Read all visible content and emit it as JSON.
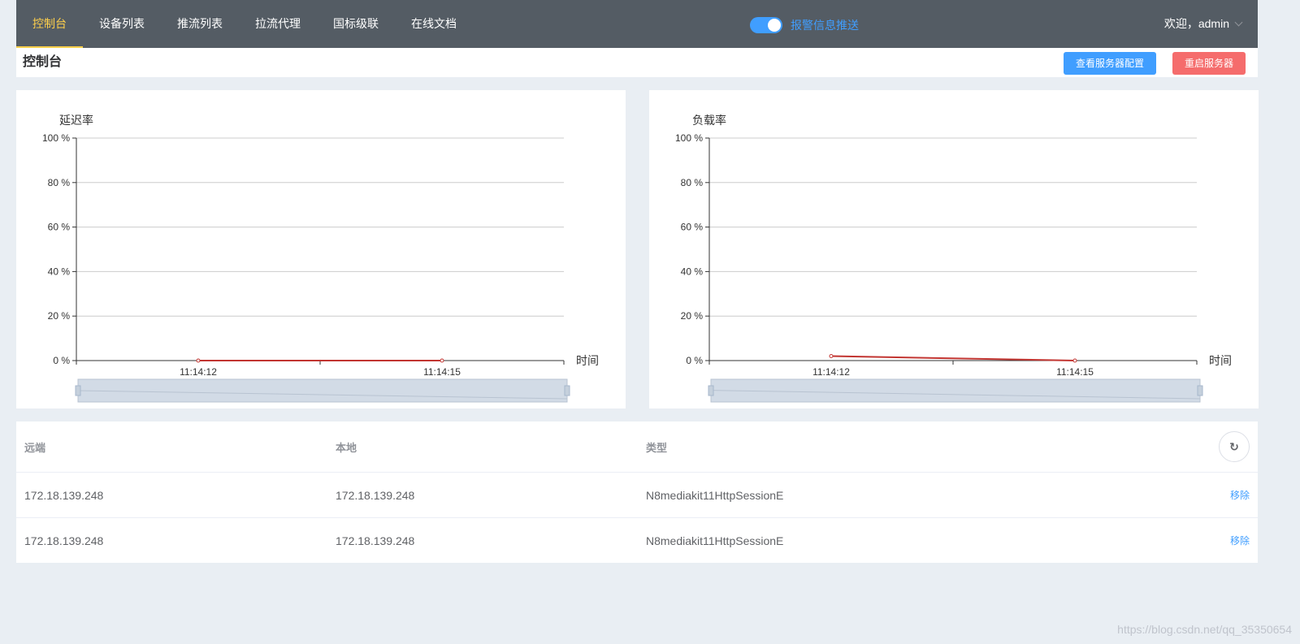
{
  "nav": {
    "items": [
      {
        "label": "控制台",
        "active": true
      },
      {
        "label": "设备列表"
      },
      {
        "label": "推流列表"
      },
      {
        "label": "拉流代理"
      },
      {
        "label": "国标级联"
      },
      {
        "label": "在线文档"
      }
    ]
  },
  "alarm": {
    "label": "报警信息推送",
    "enabled": true
  },
  "user": {
    "welcome": "欢迎，admin",
    "icon": "chevron-down-icon"
  },
  "page": {
    "title": "控制台",
    "view_config_label": "查看服务器配置",
    "restart_label": "重启服务器"
  },
  "colors": {
    "nav_bg": "#545c64",
    "nav_active": "#ffd04b",
    "primary": "#409eff",
    "danger": "#f56c6c",
    "series_line": "#c23531"
  },
  "chart_data": [
    {
      "type": "line",
      "title": "延迟率",
      "xlabel": "时间",
      "ylabel": "",
      "yticks": [
        "0 %",
        "20 %",
        "40 %",
        "60 %",
        "80 %",
        "100 %"
      ],
      "ylim": [
        0,
        100
      ],
      "categories": [
        "11:14:12",
        "11:14:15"
      ],
      "series": [
        {
          "values": [
            0,
            0
          ]
        }
      ],
      "grid": true,
      "datazoom": true
    },
    {
      "type": "line",
      "title": "负载率",
      "xlabel": "时间",
      "ylabel": "",
      "yticks": [
        "0 %",
        "20 %",
        "40 %",
        "60 %",
        "80 %",
        "100 %"
      ],
      "ylim": [
        0,
        100
      ],
      "categories": [
        "11:14:12",
        "11:14:15"
      ],
      "series": [
        {
          "values": [
            2,
            0
          ]
        }
      ],
      "grid": true,
      "datazoom": true
    }
  ],
  "table": {
    "headers": {
      "remote": "远端",
      "local": "本地",
      "type": "类型"
    },
    "refresh_icon": "refresh-icon",
    "rows": [
      {
        "remote": "172.18.139.248",
        "local": "172.18.139.248",
        "type": "N8mediakit11HttpSessionE",
        "action": "移除"
      },
      {
        "remote": "172.18.139.248",
        "local": "172.18.139.248",
        "type": "N8mediakit11HttpSessionE",
        "action": "移除"
      }
    ]
  },
  "watermark": "https://blog.csdn.net/qq_35350654"
}
